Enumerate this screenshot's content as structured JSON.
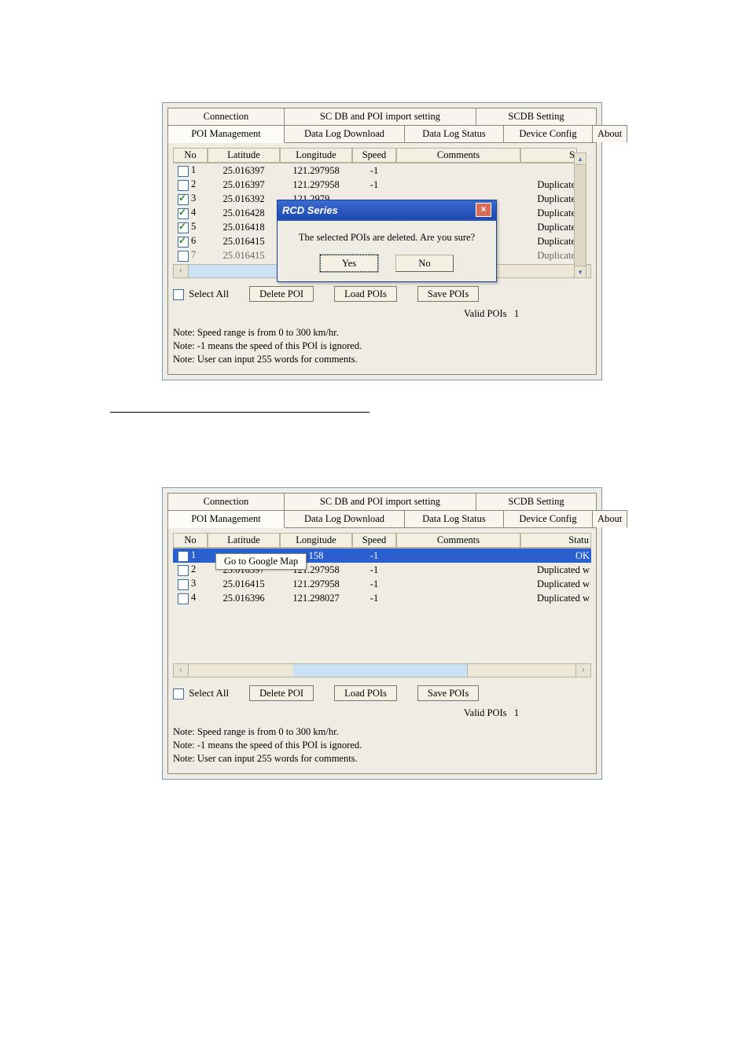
{
  "tabs_top": [
    "Connection",
    "SC DB and POI import setting",
    "SCDB  Setting"
  ],
  "tabs_bottom": [
    "POI Management",
    "Data Log Download",
    "Data Log Status",
    "Device Config",
    "About"
  ],
  "headers": {
    "no": "No",
    "lat": "Latitude",
    "lon": "Longitude",
    "spd": "Speed",
    "cmt": "Comments",
    "stat_s": "S",
    "stat_full": "Statu"
  },
  "screenshot1": {
    "rows": [
      {
        "chk": false,
        "no": "1",
        "lat": "25.016397",
        "lon": "121.297958",
        "spd": "-1",
        "cmt": "",
        "stat": ""
      },
      {
        "chk": false,
        "no": "2",
        "lat": "25.016397",
        "lon": "121.297958",
        "spd": "-1",
        "cmt": "",
        "stat": "Duplicate"
      },
      {
        "chk": true,
        "no": "3",
        "lat": "25.016392",
        "lon": "121.2979…",
        "spd": "",
        "cmt": "",
        "stat": "Duplicate"
      },
      {
        "chk": true,
        "no": "4",
        "lat": "25.016428",
        "lon": "",
        "spd": "",
        "cmt": "",
        "stat": "Duplicate"
      },
      {
        "chk": true,
        "no": "5",
        "lat": "25.016418",
        "lon": "",
        "spd": "",
        "cmt": "",
        "stat": "Duplicate"
      },
      {
        "chk": true,
        "no": "6",
        "lat": "25.016415",
        "lon": "",
        "spd": "",
        "cmt": "",
        "stat": "Duplicate"
      },
      {
        "chk": false,
        "no": "7",
        "lat": "25.016415",
        "lon": "",
        "spd": "",
        "cmt": "",
        "stat": "Duplicate",
        "partial": true
      }
    ],
    "dlg_title": "RCD Series",
    "dlg_msg": "The selected POIs  are deleted. Are you sure?",
    "dlg_yes": "Yes",
    "dlg_no": "No"
  },
  "screenshot2": {
    "rows": [
      {
        "chk": false,
        "no": "1",
        "lat": "",
        "lon": "158",
        "spd": "-1",
        "cmt": "",
        "stat": "OK",
        "selected": true
      },
      {
        "chk": false,
        "no": "2",
        "lat": "25.016397",
        "lon": "121.297958",
        "spd": "-1",
        "cmt": "",
        "stat": "Duplicated w"
      },
      {
        "chk": false,
        "no": "3",
        "lat": "25.016415",
        "lon": "121.297958",
        "spd": "-1",
        "cmt": "",
        "stat": "Duplicated w"
      },
      {
        "chk": false,
        "no": "4",
        "lat": "25.016396",
        "lon": "121.298027",
        "spd": "-1",
        "cmt": "",
        "stat": "Duplicated w"
      }
    ],
    "context_item": "Go to Google Map"
  },
  "bottom": {
    "select_all": "Select All",
    "delete": "Delete POI",
    "load": "Load POIs",
    "save": "Save POIs",
    "valid_label": "Valid POIs",
    "valid_count": "1",
    "note1": "Note: Speed range is from 0 to 300 km/hr.",
    "note2": "Note: -1 means the speed of this POI is ignored.",
    "note3": "Note:  User can input 255 words for comments."
  }
}
